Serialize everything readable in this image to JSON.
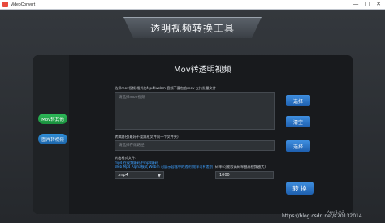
{
  "window": {
    "title": "VideoConvert",
    "minimize": "—",
    "maximize": "□",
    "close": "✕"
  },
  "banner": {
    "title": "透明视频转换工具"
  },
  "sidebar": {
    "items": [
      {
        "label": "Mov转其他",
        "active": true
      },
      {
        "label": "图片转视频",
        "active": false
      }
    ]
  },
  "main": {
    "heading": "Mov转透明视频",
    "source": {
      "label": "选择mov视频 格式为Mp4/webm 音频不要包含mov 支持批量文件",
      "placeholder": "请选择mov视频",
      "select_button": "选择",
      "clear_button": "清空"
    },
    "output": {
      "label": "转换路径(最好不要跟原文件同一个文件夹)",
      "placeholder": "请选择存储路径",
      "select_button": "选择"
    },
    "format": {
      "label": "转出格式文件:",
      "hint_1": "mp4 在视频编码中mp4编码",
      "hint_2": "Web Mp4 Alpha模式 Webm 可展示容器中的透明 效率可有差别",
      "selected": ".mp4"
    },
    "bitrate": {
      "label": "码率(可能较高码率越高视频越大)",
      "value": "1000"
    },
    "convert_button": "转 换"
  },
  "footer": {
    "version": "App: 1.0.2",
    "watermark": "https://blog.csdn.net/K20132014"
  },
  "colors": {
    "accent_blue": "#2f8ed8",
    "accent_green": "#22a84b",
    "panel_bg": "#181a1d"
  }
}
